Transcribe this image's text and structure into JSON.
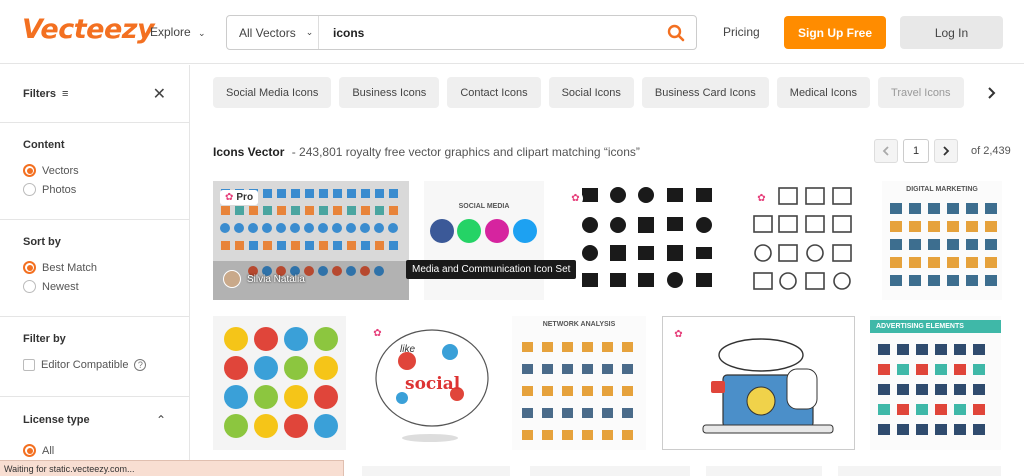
{
  "header": {
    "logo": "Vecteezy",
    "explore_label": "Explore",
    "search_type": "All Vectors",
    "search_value": "icons",
    "pricing_label": "Pricing",
    "signup_label": "Sign Up Free",
    "login_label": "Log In"
  },
  "sidebar": {
    "filters_title": "Filters",
    "content": {
      "title": "Content",
      "options": [
        {
          "label": "Vectors",
          "checked": true
        },
        {
          "label": "Photos",
          "checked": false
        }
      ]
    },
    "sort": {
      "title": "Sort by",
      "options": [
        {
          "label": "Best Match",
          "checked": true
        },
        {
          "label": "Newest",
          "checked": false
        }
      ]
    },
    "filter_by": {
      "title": "Filter by",
      "option": "Editor Compatible"
    },
    "license": {
      "title": "License type",
      "option": "All"
    }
  },
  "tags": [
    "Social Media Icons",
    "Business Icons",
    "Contact Icons",
    "Social Icons",
    "Business Card Icons",
    "Medical Icons",
    "Travel Icons"
  ],
  "results": {
    "title": "Icons Vector",
    "subtitle": "- 243,801 royalty free vector graphics and clipart matching “icons”",
    "page": "1",
    "of_pages": "of 2,439"
  },
  "tiles": {
    "first_badge": "Pro",
    "first_author": "Silvia Natalia",
    "tooltip": "Media and Communication Icon Set",
    "social_media_caption": "SOCIAL MEDIA",
    "digital_marketing_caption": "DIGITAL MARKETING",
    "network_caption": "NETWORK ANALYSIS",
    "advertising_caption": "ADVERTISING ELEMENTS",
    "social_word": "social",
    "like_word": "like"
  },
  "status": "Waiting for static.vecteezy.com...",
  "colors": {
    "brand": "#f37021",
    "cta": "#ff8c00",
    "pro_star": "#e63e7a"
  }
}
